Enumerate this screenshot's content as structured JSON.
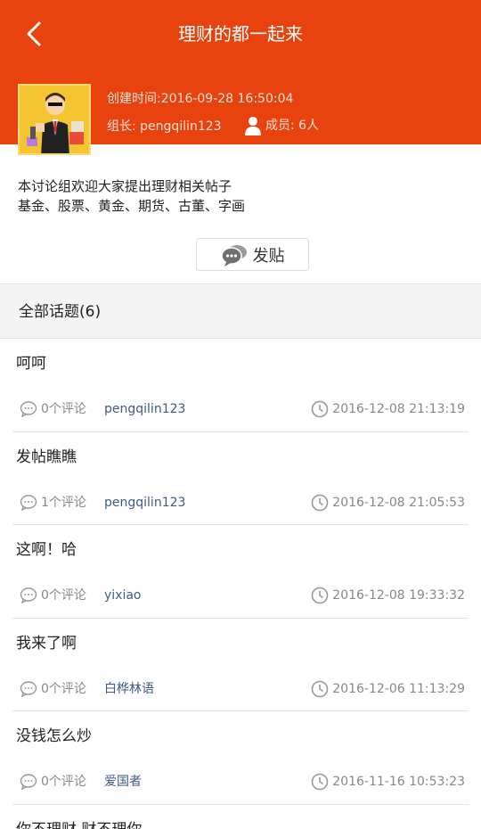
{
  "header": {
    "title": "理财的都一起来",
    "back_icon": "chevron-left-icon",
    "background_color": "#e8430f"
  },
  "group": {
    "created": "创建时间:2016-09-28 16:50:04",
    "leader": "组长: pengqilin123",
    "members": "成员: 6人",
    "intro_line1": "本讨论组欢迎大家提出理财相关帖子",
    "intro_line2": "基金、股票、黄金、期货、古董、字画"
  },
  "post_button": {
    "label": "发贴",
    "icon": "chat-bubbles-icon"
  },
  "section": {
    "title": "全部话题(6)"
  },
  "topics": [
    {
      "title": "呵呵",
      "comments": "0个评论",
      "author": "pengqilin123",
      "time": "2016-12-08 21:13:19"
    },
    {
      "title": "发帖瞧瞧",
      "comments": "1个评论",
      "author": "pengqilin123",
      "time": "2016-12-08 21:05:53"
    },
    {
      "title": "这啊！哈",
      "comments": "0个评论",
      "author": "yixiao",
      "time": "2016-12-08 19:33:32"
    },
    {
      "title": "我来了啊",
      "comments": "0个评论",
      "author": "白桦林语",
      "time": "2016-12-06 11:13:29"
    },
    {
      "title": "没钱怎么炒",
      "comments": "0个评论",
      "author": "爱国者",
      "time": "2016-11-16 10:53:23"
    },
    {
      "title": "你不理财 财不理你"
    }
  ],
  "colors": {
    "author_link": "#3e5a86",
    "muted_text": "#888888"
  }
}
